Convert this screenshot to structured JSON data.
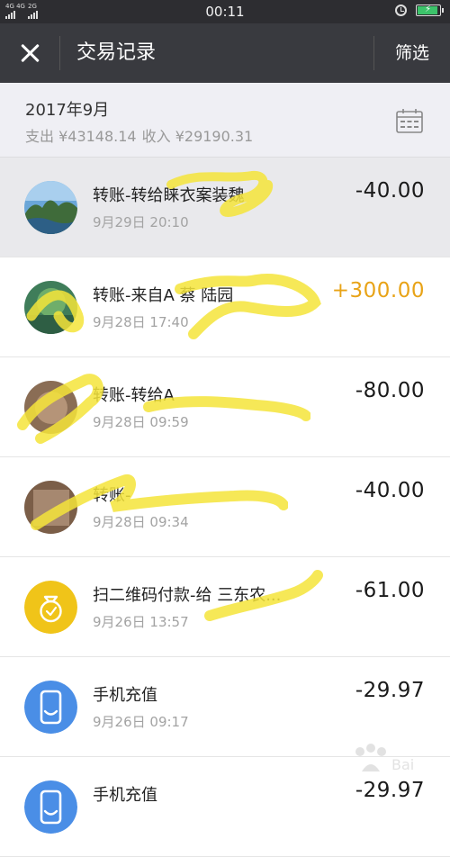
{
  "status_bar": {
    "network1": "4G 4G",
    "network2": "2G",
    "time": "00:11"
  },
  "nav": {
    "title": "交易记录",
    "filter_label": "筛选"
  },
  "summary": {
    "month": "2017年9月",
    "expense": "支出 ¥43148.14",
    "income": "收入 ¥29190.31"
  },
  "transactions": [
    {
      "title": "转账-转给睐衣案装魏",
      "time": "9月29日 20:10",
      "amount": "-40.00",
      "avatar": "landscape-photo",
      "highlight": true
    },
    {
      "title": "转账-来自A 蔡 陆园",
      "time": "9月28日 17:40",
      "amount": "+300.00",
      "avatar": "green-photo",
      "positive": true
    },
    {
      "title": "转账-转给A",
      "time": "9月28日 09:59",
      "amount": "-80.00",
      "avatar": "brown-photo"
    },
    {
      "title": "转账-",
      "time": "9月28日 09:34",
      "amount": "-40.00",
      "avatar": "brown-photo"
    },
    {
      "title": "扫二维码付款-给 三东农...",
      "time": "9月26日 13:57",
      "amount": "-61.00",
      "avatar": "money-bag-icon"
    },
    {
      "title": "手机充值",
      "time": "9月26日 09:17",
      "amount": "-29.97",
      "avatar": "phone-recharge-icon"
    },
    {
      "title": "手机充值",
      "time": "",
      "amount": "-29.97",
      "avatar": "phone-recharge-icon"
    }
  ],
  "colors": {
    "statusbar": "#2d2d31",
    "navbar": "#393a3f",
    "income_amount": "#e8a317",
    "money_bag": "#f0c419",
    "phone_icon": "#4a8ee6"
  }
}
